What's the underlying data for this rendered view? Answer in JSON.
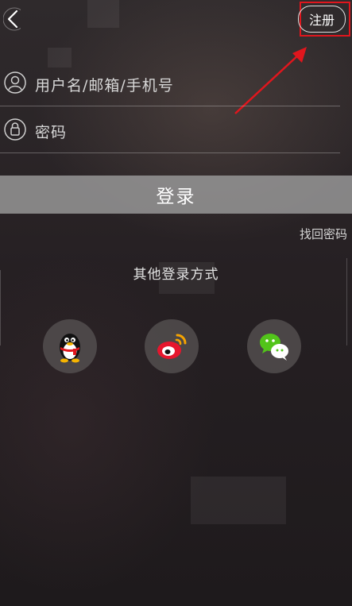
{
  "header": {
    "register_label": "注册"
  },
  "form": {
    "username_placeholder": "用户名/邮箱/手机号",
    "password_placeholder": "密码",
    "login_label": "登录",
    "forgot_label": "找回密码"
  },
  "social": {
    "title": "其他登录方式",
    "providers": [
      "qq-icon",
      "weibo-icon",
      "wechat-icon"
    ]
  },
  "colors": {
    "highlight": "#e0161d",
    "login_button": "#9b9b9b"
  }
}
